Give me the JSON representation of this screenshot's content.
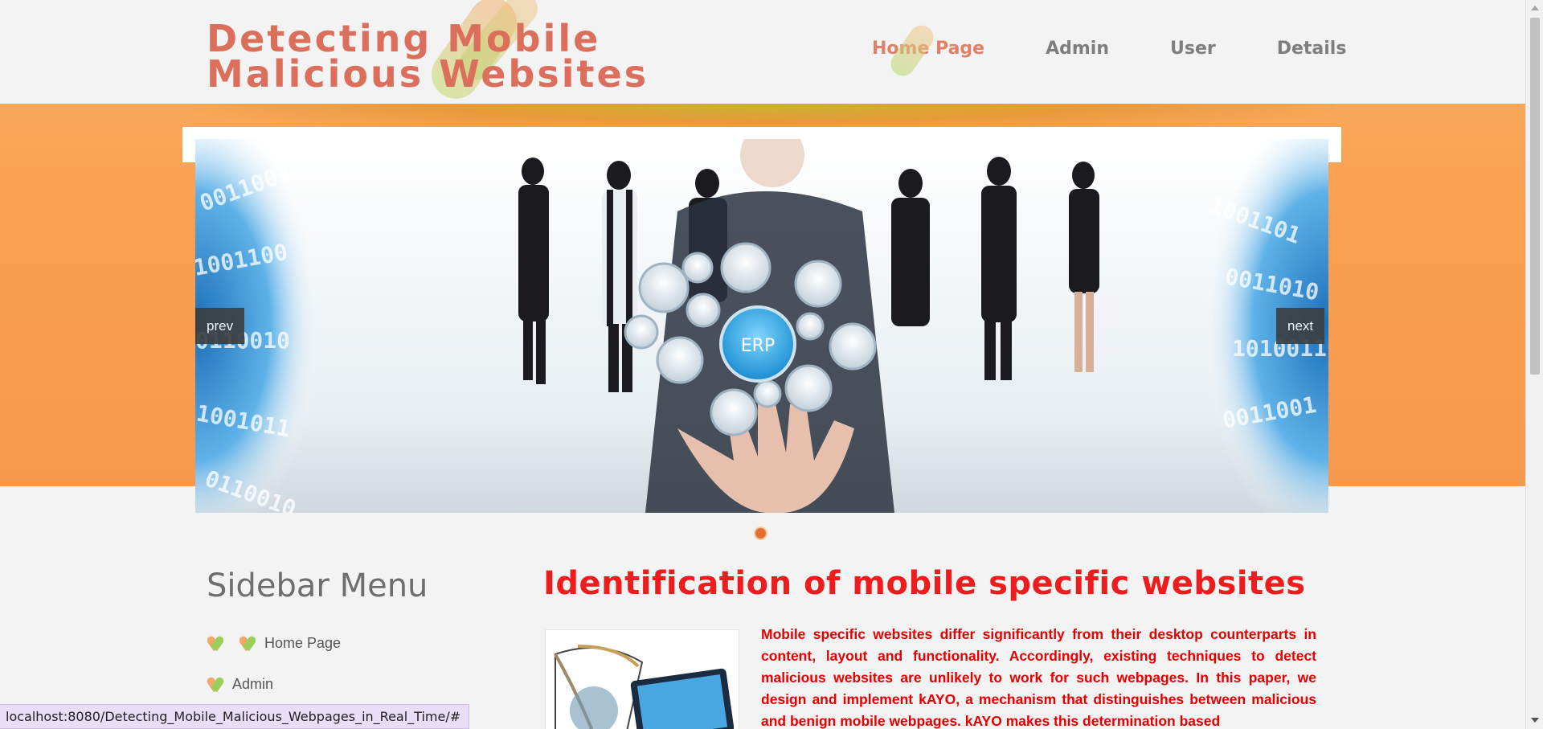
{
  "header": {
    "site_title": "Detecting Mobile Malicious Websites",
    "nav": [
      {
        "label": "Home Page",
        "active": true
      },
      {
        "label": "Admin",
        "active": false
      },
      {
        "label": "User",
        "active": false
      },
      {
        "label": "Details",
        "active": false
      }
    ]
  },
  "slider": {
    "prev_label": "prev",
    "next_label": "next",
    "center_badge": "ERP",
    "slide_count": 1
  },
  "sidebar": {
    "title": "Sidebar Menu",
    "items": [
      {
        "label": "Home Page"
      },
      {
        "label": "Admin"
      }
    ]
  },
  "main": {
    "title": "Identification of mobile specific websites",
    "text": "Mobile specific websites differ significantly from their desktop counterparts in content, layout and functionality. Accordingly, existing techniques to detect malicious websites are unlikely to work for such webpages. In this paper, we design and implement kAYO, a mechanism that distinguishes between malicious and benign mobile webpages. kAYO makes this determination based"
  },
  "status_bar": {
    "url": "localhost:8080/Detecting_Mobile_Malicious_Webpages_in_Real_Time/#"
  },
  "colors": {
    "title": "#dc6f5c",
    "nav_active": "#e0806a",
    "banner": "#f8a050",
    "heading_red": "#ee1c1c",
    "text_red": "#e60000"
  }
}
